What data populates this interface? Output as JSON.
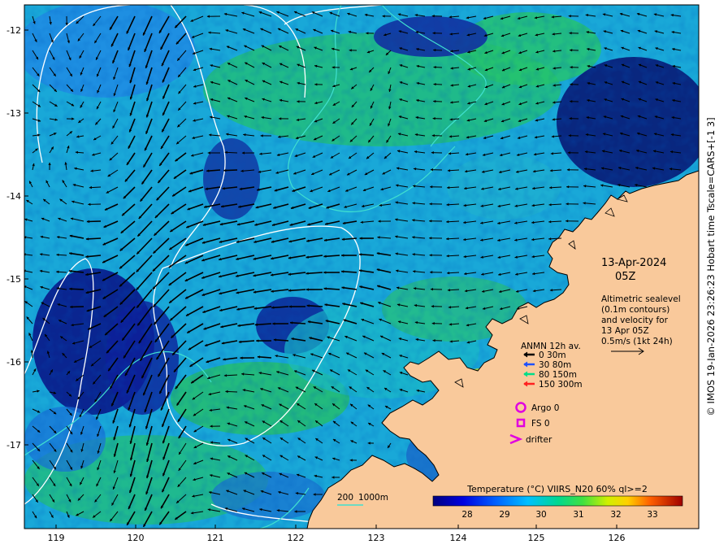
{
  "map": {
    "date": "13-Apr-2024",
    "time": "05Z",
    "description_lines": [
      "Altimetric sealevel",
      "(0.1m contours)",
      "and velocity for",
      "13 Apr 05Z",
      "0.5m/s (1kt 24h)"
    ],
    "credit": "© IMOS 19-Jan-2026 23:26:23 Hobart time Tscale=CARS+[-1 3]",
    "lat_ticks": [
      "-12",
      "-13",
      "-14",
      "-15",
      "-16",
      "-17"
    ],
    "lon_ticks": [
      "119",
      "120",
      "121",
      "122",
      "123",
      "124",
      "125",
      "126"
    ],
    "colors": {
      "land": "#f9c99b",
      "ocean_base": "#19a8d8",
      "contour": "#ffffff",
      "isobath": "#40e0d0"
    }
  },
  "anmn_legend": {
    "title": "ANMN 12h av.",
    "items": [
      {
        "label": "0 30m",
        "color": "#000000"
      },
      {
        "label": "30 80m",
        "color": "#1e50ff"
      },
      {
        "label": "80 150m",
        "color": "#00dd88"
      },
      {
        "label": "150 300m",
        "color": "#ff2020"
      }
    ]
  },
  "platforms": [
    {
      "label": "Argo 0",
      "symbol": "circle",
      "color": "#e000e0"
    },
    {
      "label": "FS 0",
      "symbol": "square",
      "color": "#e000e0"
    },
    {
      "label": "drifter",
      "symbol": "chevron",
      "color": "#e000e0"
    }
  ],
  "isobath_legend": {
    "label_a": "200",
    "label_b": "1000m"
  },
  "colorbar": {
    "title": "Temperature (°C) VIIRS_N20 60% ql>=2",
    "ticks": [
      "28",
      "29",
      "30",
      "31",
      "32",
      "33"
    ],
    "range": [
      27.3,
      33.8
    ]
  }
}
